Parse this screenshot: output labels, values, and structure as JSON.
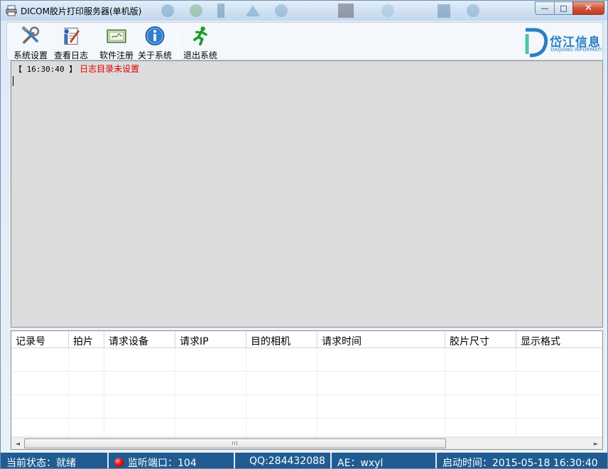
{
  "window": {
    "title": "DICOM胶片打印服务器(单机版)",
    "close_glyph": "✕",
    "minimize_glyph": "—",
    "maximize_glyph": "□"
  },
  "toolbar": {
    "buttons": [
      {
        "label": "系统设置",
        "icon": "tools-icon"
      },
      {
        "label": "查看日志",
        "icon": "log-notebook-icon"
      },
      {
        "label": "软件注册",
        "icon": "certificate-icon"
      },
      {
        "label": "关于系统",
        "icon": "info-icon"
      },
      {
        "label": "退出系统",
        "icon": "running-man-icon"
      }
    ],
    "logo": {
      "text": "岱江信息",
      "subtext": "DAIJIANG INFORMATI",
      "color": "#2a7fc4"
    }
  },
  "log": {
    "time": "【 16:30:40 】",
    "message": "日志目录未设置",
    "message_color": "#e00000"
  },
  "table": {
    "columns": [
      "记录号",
      "拍片",
      "请求设备",
      "请求IP",
      "目的相机",
      "请求时间",
      "胶片尺寸",
      "显示格式"
    ],
    "scroll_thumb_glyph": "III",
    "scroll_left_glyph": "◄",
    "scroll_right_glyph": "►"
  },
  "statusbar": {
    "state": "当前状态：就绪",
    "port": "监听端口：104",
    "qq": "QQ:284432088",
    "ae": "AE：wxyl",
    "start_time": "启动时间：2015-05-18 16:30:40",
    "bg_color": "#1f5c91"
  }
}
